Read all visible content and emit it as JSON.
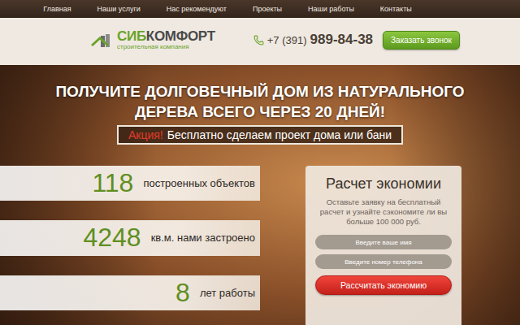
{
  "nav": {
    "items": [
      "Главная",
      "Наши услуги",
      "Нас рекомендуют",
      "Проекты",
      "Наши работы",
      "Контакты"
    ]
  },
  "logo": {
    "brand": [
      {
        "text": "СИБ",
        "color": "#6aa32a"
      },
      {
        "text": "КОМФОРТ",
        "color": "#4a4a4a"
      }
    ],
    "tagline": "строительная компания"
  },
  "contact": {
    "prefix": "+7 (391)",
    "number": "989-84-38",
    "button": "Заказать звонок"
  },
  "hero": {
    "title": "ПОЛУЧИТЕ ДОЛГОВЕЧНЫЙ ДОМ ИЗ НАТУРАЛЬНОГО ДЕРЕВА ВСЕГО ЧЕРЕЗ 20 ДНЕЙ!",
    "promo": {
      "label": "Акция!",
      "text": "Бесплатно сделаем проект дома или бани"
    }
  },
  "stats": [
    {
      "value": "118",
      "label": "построенных объектов"
    },
    {
      "value": "4248",
      "label": "кв.м. нами застроено"
    },
    {
      "value": "8",
      "label": "лет работы"
    }
  ],
  "form": {
    "title": "Расчет экономии",
    "subtitle": "Оставьте заявку на бесплатный расчет и узнайте сэкономите ли вы больше 100 000 руб.",
    "fields": [
      {
        "placeholder": "Введите ваше имя"
      },
      {
        "placeholder": "Введите номер телефона"
      }
    ],
    "button": "Рассчитать экономию"
  }
}
